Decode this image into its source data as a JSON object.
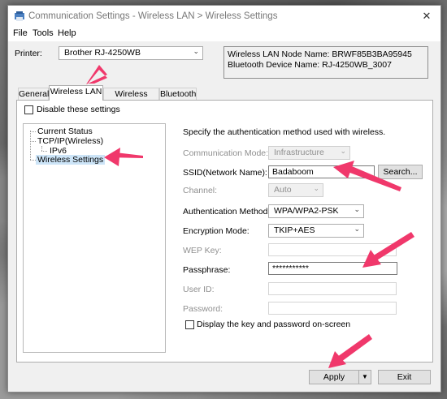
{
  "window": {
    "title": "Communication Settings - Wireless LAN > Wireless Settings",
    "close_symbol": "✕"
  },
  "menu": {
    "file": "File",
    "tools": "Tools",
    "help": "Help"
  },
  "printer": {
    "label": "Printer:",
    "selected": "Brother RJ-4250WB"
  },
  "info": {
    "wlan_node": "Wireless LAN Node Name: BRWF85B3BA95945",
    "bt_name": "Bluetooth Device Name: RJ-4250WB_3007"
  },
  "tabs": {
    "general": "General",
    "wireless_lan": "Wireless LAN",
    "wireless_direct": "Wireless Direct",
    "bluetooth": "Bluetooth"
  },
  "disable_settings": {
    "label": "Disable these settings",
    "checked": false
  },
  "tree": {
    "current_status": "Current Status",
    "tcpip": "TCP/IP(Wireless)",
    "ipv6": "IPv6",
    "wireless_settings": "Wireless Settings"
  },
  "form": {
    "instruction": "Specify the authentication method used with wireless.",
    "comm_mode": {
      "label": "Communication Mode:",
      "value": "Infrastructure"
    },
    "ssid": {
      "label": "SSID(Network Name):",
      "value": "Badaboom",
      "search_label": "Search..."
    },
    "channel": {
      "label": "Channel:",
      "value": "Auto"
    },
    "auth": {
      "label": "Authentication Method:",
      "value": "WPA/WPA2-PSK"
    },
    "encryption": {
      "label": "Encryption Mode:",
      "value": "TKIP+AES"
    },
    "wep": {
      "label": "WEP Key:",
      "value": ""
    },
    "passphrase": {
      "label": "Passphrase:",
      "value": "***********"
    },
    "userid": {
      "label": "User ID:",
      "value": ""
    },
    "password": {
      "label": "Password:",
      "value": ""
    },
    "display_key": {
      "label": "Display the key and password on-screen",
      "checked": false
    }
  },
  "footer": {
    "apply": "Apply",
    "exit": "Exit"
  },
  "annotation_color": "#f0386b"
}
